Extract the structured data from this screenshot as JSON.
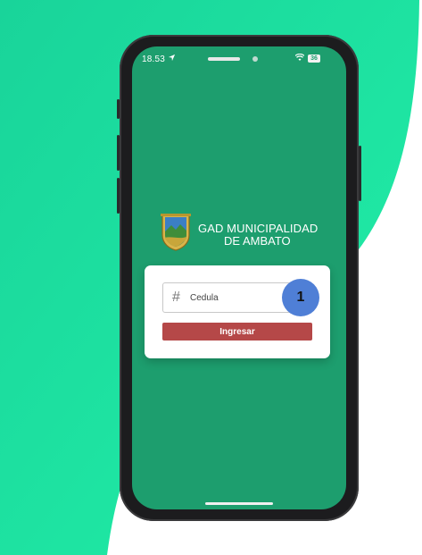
{
  "status_bar": {
    "time": "18.53",
    "location_icon": "location-arrow-icon",
    "wifi_icon": "wifi-icon",
    "battery": "36"
  },
  "header": {
    "emblem_icon": "municipal-coat-of-arms-icon",
    "title_line1": "GAD MUNICIPALIDAD",
    "title_line2": "DE AMBATO"
  },
  "login_form": {
    "id_field": {
      "icon": "hash-icon",
      "placeholder": "Cedula",
      "value": ""
    },
    "step_badge": "1",
    "submit_label": "Ingresar"
  },
  "colors": {
    "screen_background": "#1d9e6e",
    "page_accent": "#1ee6a0",
    "button": "#b54848",
    "step_badge": "#4f7fd6"
  }
}
